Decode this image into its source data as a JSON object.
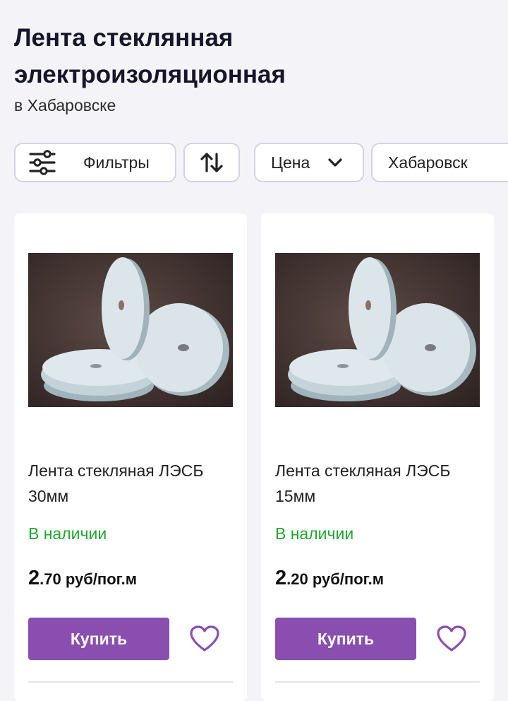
{
  "page": {
    "title": "Лента стеклянная электроизоляционная",
    "subtitle": "в Хабаровске"
  },
  "filters": {
    "filters_label": "Фильтры",
    "price_label": "Цена",
    "city_label": "Хабаровск"
  },
  "products": [
    {
      "name": "Лента стекляная ЛЭСБ 30мм",
      "stock": "В наличии",
      "price_int": "2",
      "price_rest": ".70 руб/пог.м",
      "buy_label": "Купить"
    },
    {
      "name": "Лента стекляная ЛЭСБ 15мм",
      "stock": "В наличии",
      "price_int": "2",
      "price_rest": ".20 руб/пог.м",
      "buy_label": "Купить"
    }
  ],
  "colors": {
    "accent": "#8a4eb0",
    "in_stock": "#1fa830",
    "chip_border": "#d3d3e3"
  }
}
